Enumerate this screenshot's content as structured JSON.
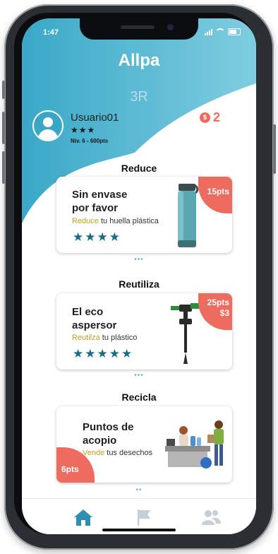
{
  "status": {
    "time": "1:47"
  },
  "app": {
    "title": "Allpa",
    "subtitle": "3R"
  },
  "user": {
    "name": "Usuario01",
    "stars": "★★★",
    "level": "Niv. 6 - 600pts",
    "coins": "2",
    "coin_symbol": "$"
  },
  "sections": [
    {
      "title": "Reduce",
      "card": {
        "title_line1": "Sin envase",
        "title_line2": "por favor",
        "action": "Reduce",
        "rest": " tu huella plástica",
        "stars": "★★★★",
        "badge": "15pts",
        "image": "water-bottle-icon"
      }
    },
    {
      "title": "Reutiliza",
      "card": {
        "title_line1": "El eco",
        "title_line2": "aspersor",
        "action": "Reutilza",
        "rest": " tu plástico",
        "stars": "★★★★★",
        "badge_line1": "25pts",
        "badge_line2": "$3",
        "image": "sprinkler-icon"
      }
    },
    {
      "title": "Recicla",
      "card": {
        "title_line1": "Puntos de",
        "title_line2": "acopio",
        "action": "Vende",
        "rest": " tus desechos",
        "badge": "6pts",
        "image": "recycling-point-illustration"
      }
    }
  ],
  "pager_dots": [
    "•••",
    "•••",
    "••"
  ],
  "tabs": {
    "home": "home-icon",
    "flag": "flag-icon",
    "users": "users-icon"
  },
  "colors": {
    "accent": "#3aa6c5",
    "badge": "#ee6b60",
    "stars": "#166e85",
    "highlight": "#b9a21d"
  }
}
